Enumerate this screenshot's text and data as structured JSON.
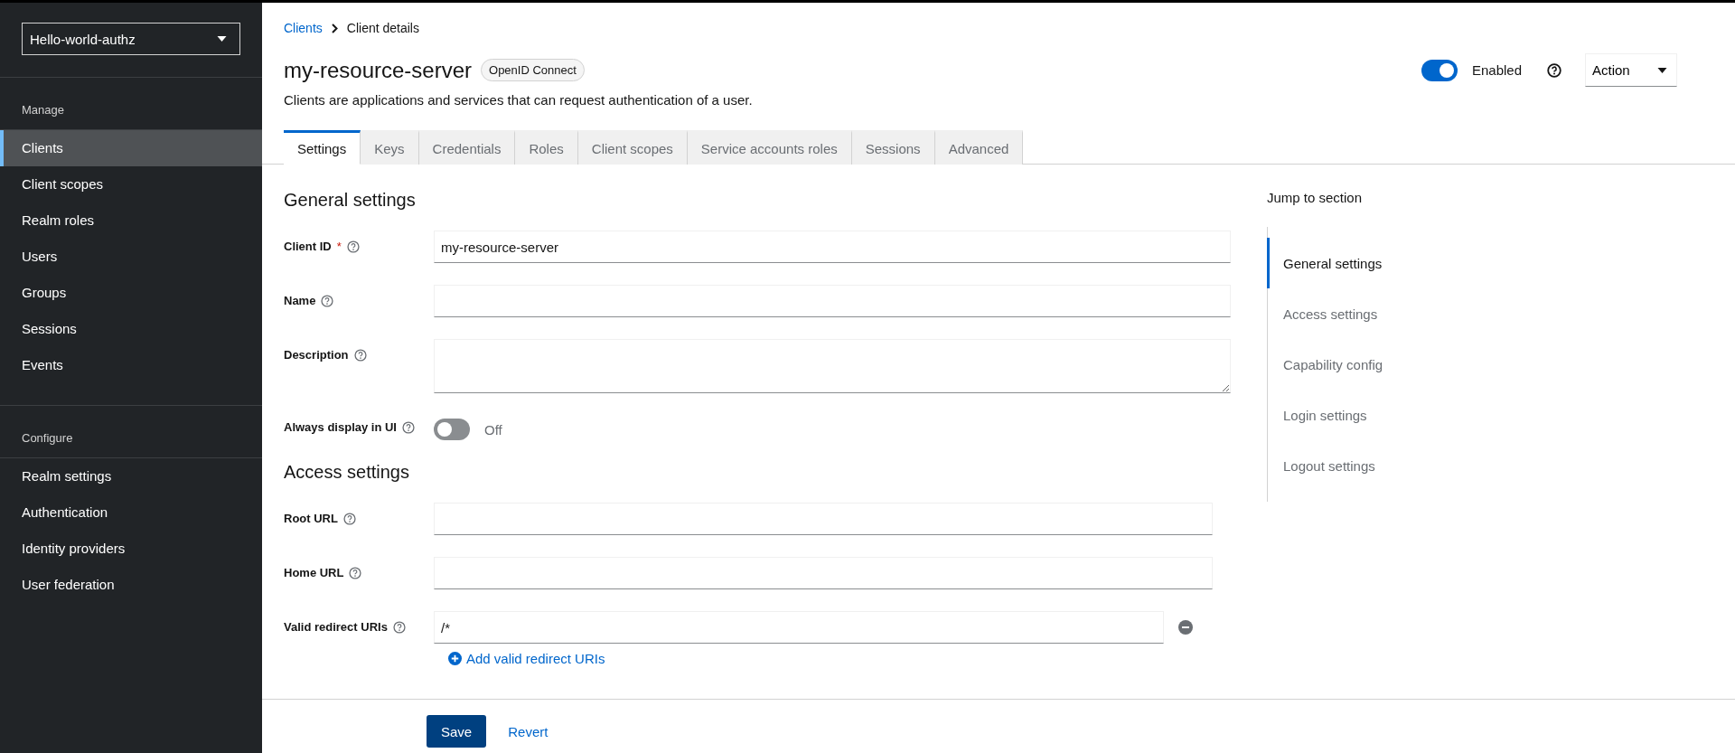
{
  "sidebar": {
    "realm": "Hello-world-authz",
    "groups": [
      {
        "title": "Manage",
        "items": [
          {
            "label": "Clients",
            "selected": true
          },
          {
            "label": "Client scopes",
            "selected": false
          },
          {
            "label": "Realm roles",
            "selected": false
          },
          {
            "label": "Users",
            "selected": false
          },
          {
            "label": "Groups",
            "selected": false
          },
          {
            "label": "Sessions",
            "selected": false
          },
          {
            "label": "Events",
            "selected": false
          }
        ]
      },
      {
        "title": "Configure",
        "items": [
          {
            "label": "Realm settings",
            "selected": false
          },
          {
            "label": "Authentication",
            "selected": false
          },
          {
            "label": "Identity providers",
            "selected": false
          },
          {
            "label": "User federation",
            "selected": false
          }
        ]
      }
    ]
  },
  "breadcrumb": [
    {
      "label": "Clients",
      "link": true
    },
    {
      "label": "Client details",
      "link": false
    }
  ],
  "header": {
    "title": "my-resource-server",
    "badge": "OpenID Connect",
    "description": "Clients are applications and services that can request authentication of a user.",
    "enabled": {
      "label": "Enabled",
      "on": true
    },
    "action": "Action"
  },
  "tabs": [
    {
      "label": "Settings",
      "selected": true
    },
    {
      "label": "Keys",
      "selected": false
    },
    {
      "label": "Credentials",
      "selected": false
    },
    {
      "label": "Roles",
      "selected": false
    },
    {
      "label": "Client scopes",
      "selected": false
    },
    {
      "label": "Service accounts roles",
      "selected": false
    },
    {
      "label": "Sessions",
      "selected": false
    },
    {
      "label": "Advanced",
      "selected": false
    }
  ],
  "sections": [
    {
      "title": "General settings",
      "fields": [
        {
          "kind": "text",
          "label": "Client ID",
          "required": true,
          "required_mark": "*",
          "value": "my-resource-server"
        },
        {
          "kind": "text",
          "label": "Name",
          "required": false
        },
        {
          "kind": "textarea",
          "label": "Description",
          "required": false
        },
        {
          "kind": "switch",
          "label": "Always display in UI",
          "required": false,
          "on": false,
          "state_label": "Off"
        }
      ]
    },
    {
      "title": "Access settings",
      "fields": [
        {
          "kind": "url",
          "label": "Root URL",
          "required": false
        },
        {
          "kind": "url",
          "label": "Home URL",
          "required": false
        },
        {
          "kind": "multi",
          "label": "Valid redirect URIs",
          "required": false,
          "value": "/*",
          "add_label": "Add valid redirect URIs"
        }
      ]
    }
  ],
  "jump": {
    "title": "Jump to section",
    "items": [
      {
        "label": "General settings",
        "selected": true
      },
      {
        "label": "Access settings",
        "selected": false
      },
      {
        "label": "Capability config",
        "selected": false
      },
      {
        "label": "Login settings",
        "selected": false
      },
      {
        "label": "Logout settings",
        "selected": false
      }
    ]
  },
  "footer": {
    "save": "Save",
    "revert": "Revert"
  }
}
